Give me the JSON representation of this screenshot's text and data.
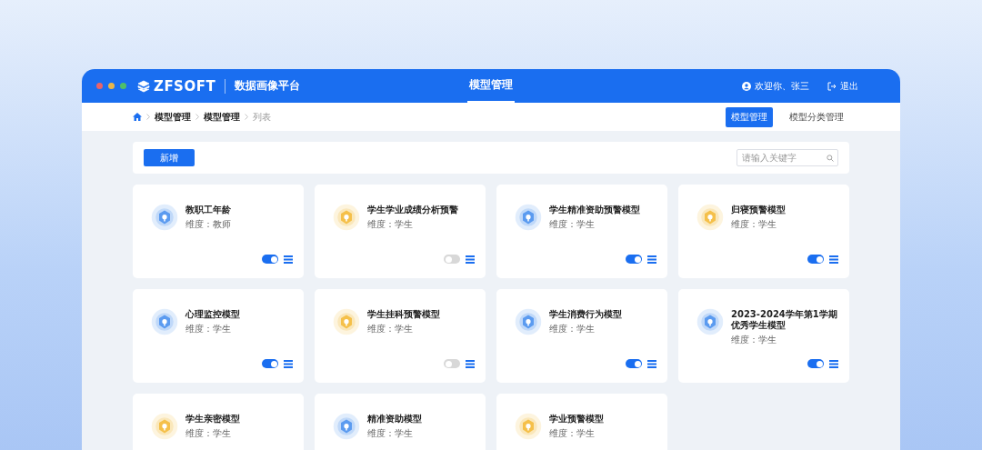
{
  "window": {
    "brand": "ZFSOFT",
    "platform": "数据画像平台"
  },
  "nav": [
    {
      "label": "模型管理",
      "selected": true
    }
  ],
  "user": {
    "greeting": "欢迎你、张三",
    "logout": "退出"
  },
  "breadcrumb": [
    {
      "label": "模型管理",
      "current": false
    },
    {
      "label": "模型管理",
      "current": false
    },
    {
      "label": "列表",
      "current": true
    }
  ],
  "tabs": [
    {
      "label": "模型管理",
      "selected": true
    },
    {
      "label": "模型分类管理",
      "selected": false
    }
  ],
  "toolbar": {
    "add_button": "新增",
    "search": {
      "placeholder": "请输入关键字"
    }
  },
  "models": [
    {
      "title": "教职工年龄",
      "dimension": "维度：教师",
      "color": "#5b9bf0",
      "on": true
    },
    {
      "title": "学生学业成绩分析预警",
      "dimension": "维度：学生",
      "color": "#f5c04a",
      "on": false
    },
    {
      "title": "学生精准资助预警模型",
      "dimension": "维度：学生",
      "color": "#5b9bf0",
      "on": true
    },
    {
      "title": "归寝预警模型",
      "dimension": "维度：学生",
      "color": "#f5c04a",
      "on": true
    },
    {
      "title": "心理监控模型",
      "dimension": "维度：学生",
      "color": "#5b9bf0",
      "on": true
    },
    {
      "title": "学生挂科预警模型",
      "dimension": "维度：学生",
      "color": "#f5c04a",
      "on": false
    },
    {
      "title": "学生消费行为模型",
      "dimension": "维度：学生",
      "color": "#5b9bf0",
      "on": true
    },
    {
      "title": "2023-2024学年第1学期优秀学生模型",
      "dimension": "维度：学生",
      "color": "#5b9bf0",
      "on": true
    },
    {
      "title": "学生亲密模型",
      "dimension": "维度：学生",
      "color": "#f5c04a"
    },
    {
      "title": "精准资助模型",
      "dimension": "维度：学生",
      "color": "#5b9bf0"
    },
    {
      "title": "学业预警模型",
      "dimension": "维度：学生",
      "color": "#f5c04a"
    }
  ]
}
